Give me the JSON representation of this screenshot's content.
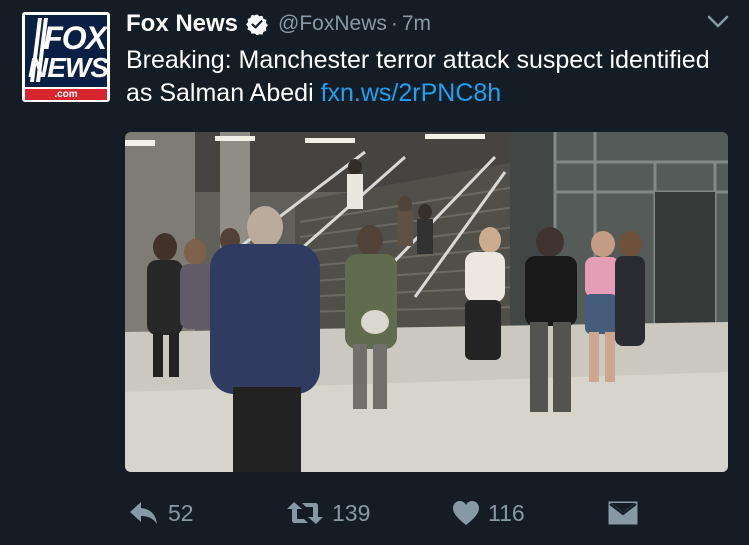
{
  "author": {
    "display_name": "Fox News",
    "handle": "@FoxNews",
    "separator": "·",
    "time": "7m",
    "logo": {
      "line1": "FOX",
      "line2": "NEWS",
      "line3": ".com"
    }
  },
  "tweet": {
    "text": "Breaking: Manchester terror attack suspect identified as Salman Abedi",
    "link": "fxn.ws/2rPNC8h"
  },
  "media": {
    "kind": "video-still"
  },
  "actions": {
    "replies": "52",
    "retweets": "139",
    "likes": "116"
  },
  "icons": {
    "verified": "verified-badge-icon",
    "menu": "chevron-down-icon",
    "reply": "reply-icon",
    "retweet": "retweet-icon",
    "like": "heart-icon",
    "dm": "envelope-icon"
  },
  "colors": {
    "background": "#141d26",
    "link": "#1da1f2",
    "muted": "#8899a6",
    "text": "#ffffff"
  }
}
